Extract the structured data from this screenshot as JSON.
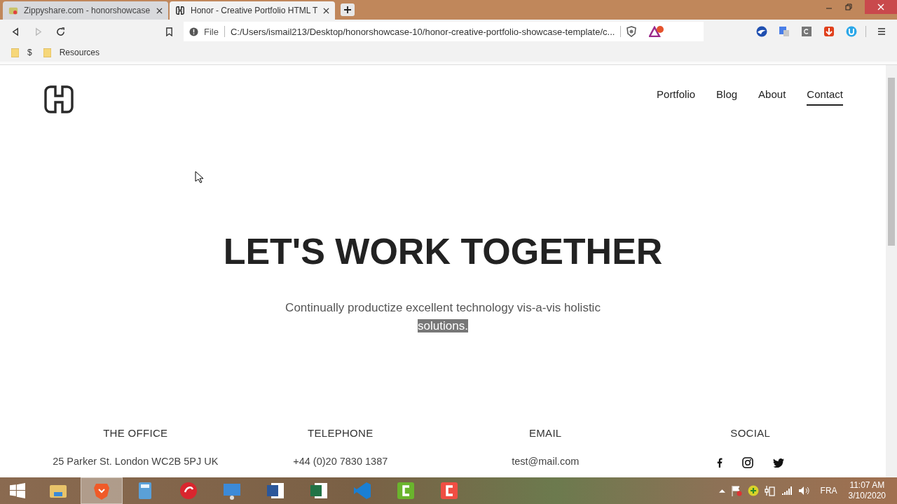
{
  "browser": {
    "tabs": [
      {
        "title": "Zippyshare.com - honorshowcase",
        "selected": false
      },
      {
        "title": "Honor - Creative Portfolio HTML T",
        "selected": true
      }
    ],
    "address": {
      "scheme": "File",
      "url": "C:/Users/ismail213/Desktop/honorshowcase-10/honor-creative-portfolio-showcase-template/c..."
    },
    "bookmarks": [
      "$",
      "Resources"
    ]
  },
  "page": {
    "nav": [
      {
        "label": "Portfolio",
        "selected": false
      },
      {
        "label": "Blog",
        "selected": false
      },
      {
        "label": "About",
        "selected": false
      },
      {
        "label": "Contact",
        "selected": true
      }
    ],
    "title": "LET'S WORK TOGETHER",
    "subtitle": "Continually productize excellent technology vis-a-vis holistic",
    "subtitle_highlighted": "solutions.",
    "contact": [
      {
        "kind": "text",
        "heading": "THE OFFICE",
        "value": "25 Parker St. London WC2B 5PJ UK"
      },
      {
        "kind": "text",
        "heading": "TELEPHONE",
        "value": "+44 (0)20 7830 1387"
      },
      {
        "kind": "text",
        "heading": "EMAIL",
        "value": "test@mail.com"
      },
      {
        "kind": "social",
        "heading": "SOCIAL"
      }
    ]
  },
  "taskbar": {
    "apps": [
      {
        "kind": "folder",
        "selected": false
      },
      {
        "kind": "brave",
        "selected": true
      },
      {
        "kind": "calculator",
        "selected": false
      },
      {
        "kind": "red-circle",
        "selected": false
      },
      {
        "kind": "panel",
        "selected": false
      },
      {
        "kind": "word",
        "selected": false
      },
      {
        "kind": "excel",
        "selected": false
      },
      {
        "kind": "code",
        "selected": false
      },
      {
        "kind": "green-c",
        "selected": false
      },
      {
        "kind": "red-c",
        "selected": false
      }
    ],
    "language": "FRA",
    "time": "11:07 AM",
    "date": "3/10/2020"
  }
}
